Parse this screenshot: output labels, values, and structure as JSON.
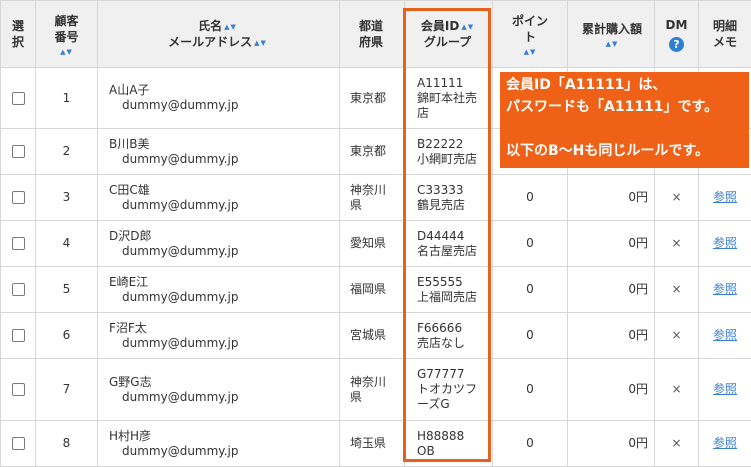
{
  "headers": {
    "select": "選\n択",
    "customer_no": "顧客\n番号",
    "name": "氏名",
    "email": "メールアドレス",
    "prefecture": "都道\n府県",
    "member_id": "会員ID",
    "group": "グループ",
    "points": "ポイン\nト",
    "total": "累計購入額",
    "dm": "DM",
    "memo": "明細\nメモ"
  },
  "sort_glyph": "▲▼",
  "help_glyph": "?",
  "rows": [
    {
      "no": "1",
      "name": "A山A子",
      "email": "dummy@dummy.jp",
      "pref": "東京都",
      "id": "A11111",
      "group": "錦町本社売\n店",
      "points": "",
      "total": "",
      "dm": "",
      "memo": ""
    },
    {
      "no": "2",
      "name": "B川B美",
      "email": "dummy@dummy.jp",
      "pref": "東京都",
      "id": "B22222",
      "group": "小網町売店",
      "points": "",
      "total": "",
      "dm": "",
      "memo": ""
    },
    {
      "no": "3",
      "name": "C田C雄",
      "email": "dummy@dummy.jp",
      "pref": "神奈川\n県",
      "id": "C33333",
      "group": "鶴見売店",
      "points": "0",
      "total": "0円",
      "dm": "×",
      "memo": "参照"
    },
    {
      "no": "4",
      "name": "D沢D郎",
      "email": "dummy@dummy.jp",
      "pref": "愛知県",
      "id": "D44444",
      "group": "名古屋売店",
      "points": "0",
      "total": "0円",
      "dm": "×",
      "memo": "参照"
    },
    {
      "no": "5",
      "name": "E崎E江",
      "email": "dummy@dummy.jp",
      "pref": "福岡県",
      "id": "E55555",
      "group": "上福岡売店",
      "points": "0",
      "total": "0円",
      "dm": "×",
      "memo": "参照"
    },
    {
      "no": "6",
      "name": "F沼F太",
      "email": "dummy@dummy.jp",
      "pref": "宮城県",
      "id": "F66666",
      "group": "売店なし",
      "points": "0",
      "total": "0円",
      "dm": "×",
      "memo": "参照"
    },
    {
      "no": "7",
      "name": "G野G志",
      "email": "dummy@dummy.jp",
      "pref": "神奈川\n県",
      "id": "G77777",
      "group": "トオカツフ\nーズG",
      "points": "0",
      "total": "0円",
      "dm": "×",
      "memo": "参照"
    },
    {
      "no": "8",
      "name": "H村H彦",
      "email": "dummy@dummy.jp",
      "pref": "埼玉県",
      "id": "H88888",
      "group": "OB",
      "points": "0",
      "total": "0円",
      "dm": "×",
      "memo": "参照"
    }
  ],
  "callout": {
    "line1": "会員ID「A11111」は、",
    "line2": "パスワードも「A11111」です。",
    "line3": "以下のB〜Hも同じルールです。"
  },
  "colors": {
    "accent": "#ee6116",
    "highlight_border": "#e8611c",
    "link": "#3b7fd1",
    "header_bg": "#f0f0f0"
  }
}
